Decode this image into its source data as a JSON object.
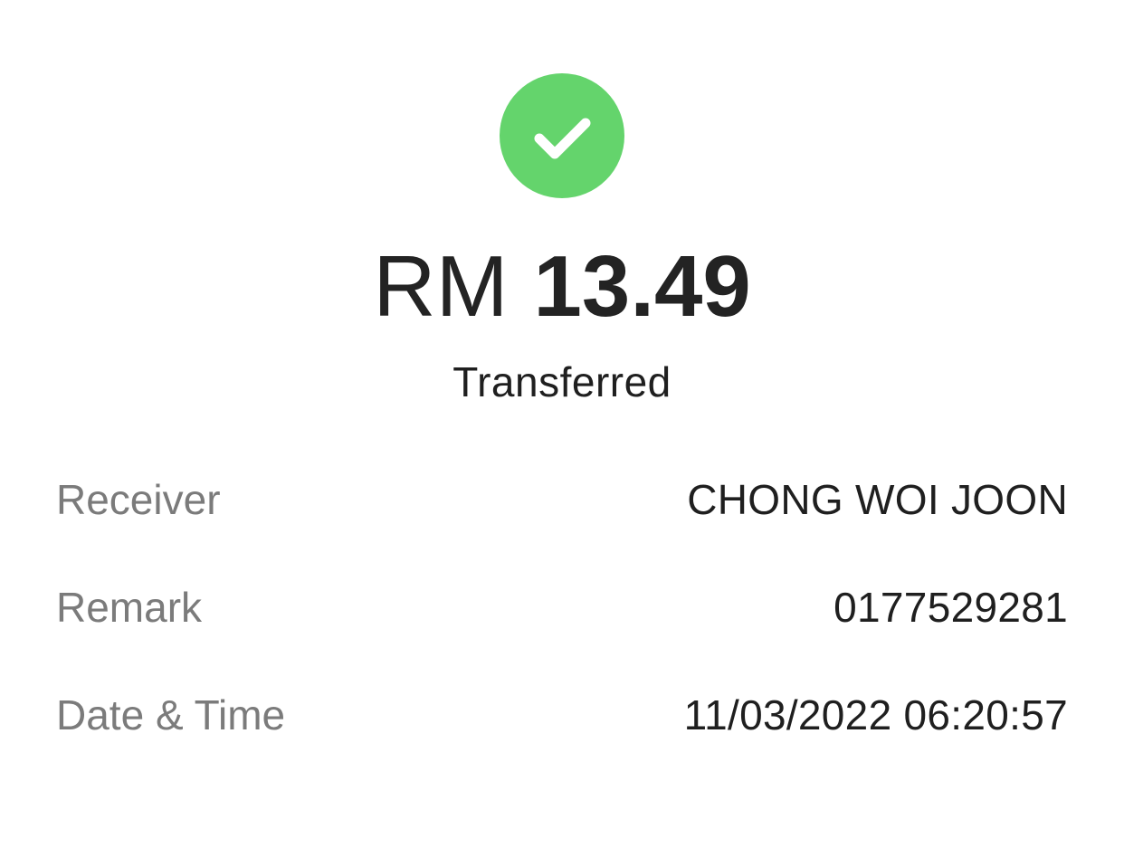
{
  "status": {
    "icon": "check-circle-icon",
    "color": "#64d46c",
    "text": "Transferred"
  },
  "amount": {
    "currency": "RM",
    "value": "13.49"
  },
  "details": {
    "receiver": {
      "label": "Receiver",
      "value": "CHONG WOI JOON"
    },
    "remark": {
      "label": "Remark",
      "value": "0177529281"
    },
    "datetime": {
      "label": "Date & Time",
      "value": "11/03/2022 06:20:57"
    }
  }
}
